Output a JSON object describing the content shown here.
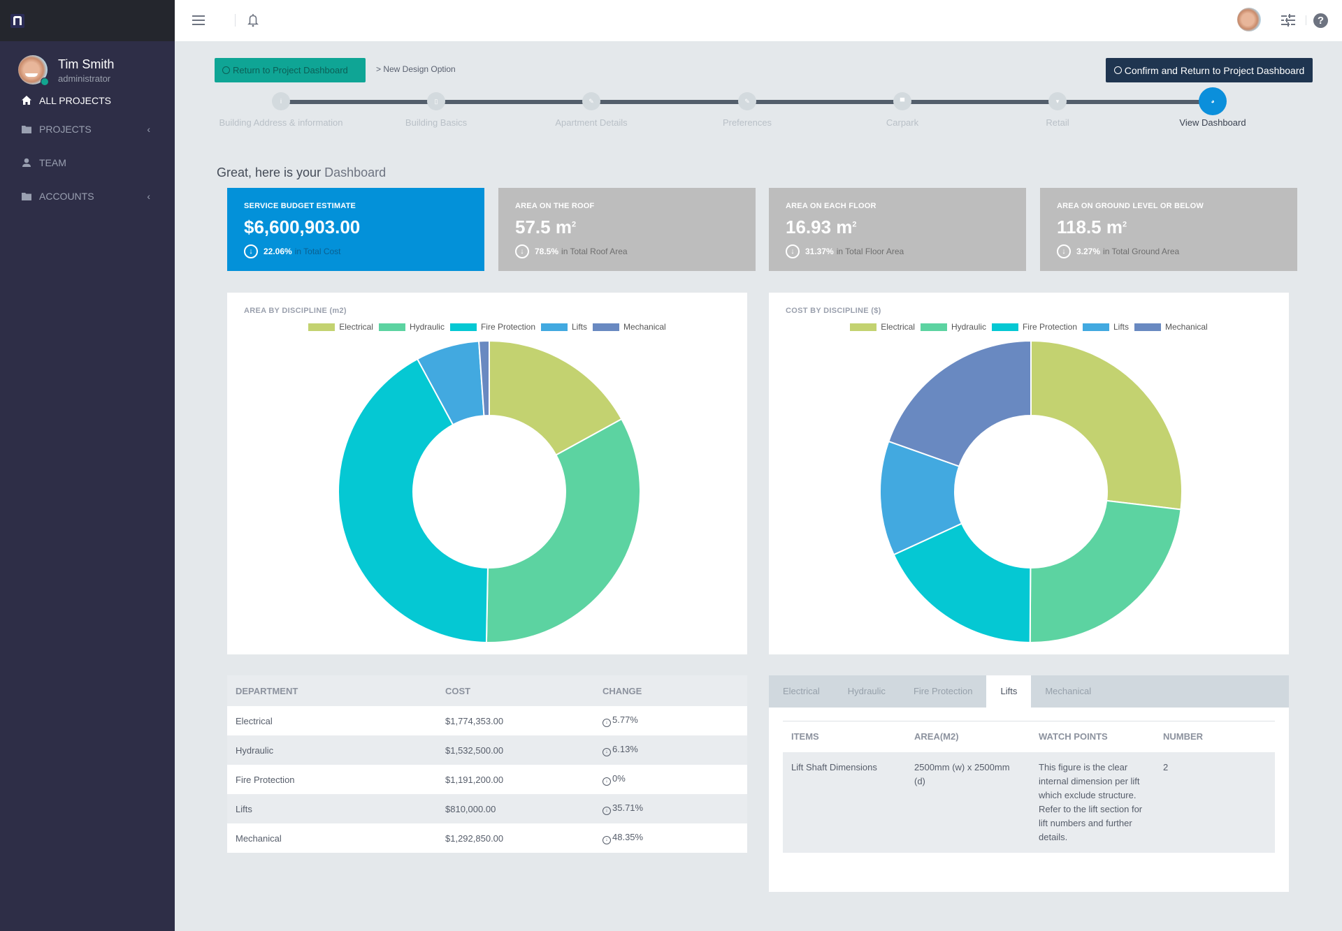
{
  "sidebar": {
    "user": {
      "name": "Tim Smith",
      "role": "administrator"
    },
    "items": [
      {
        "label": "ALL PROJECTS",
        "icon": "home-icon",
        "active": true
      },
      {
        "label": "PROJECTS",
        "icon": "folder-icon",
        "chevron": "‹"
      },
      {
        "label": "TEAM",
        "icon": "person-icon"
      },
      {
        "label": "ACCOUNTS",
        "icon": "folder-icon",
        "chevron": "‹"
      }
    ]
  },
  "header": {
    "return_button": "Return to Project Dashboard",
    "breadcrumb": "> New Design Option",
    "confirm_button": "Confirm and Return to Project Dashboard"
  },
  "steps": [
    {
      "label": "Building Address & information",
      "icon": "info-icon"
    },
    {
      "label": "Building Basics",
      "icon": "building-icon"
    },
    {
      "label": "Apartment Details",
      "icon": "wrench-icon"
    },
    {
      "label": "Preferences",
      "icon": "pencil-icon"
    },
    {
      "label": "Carpark",
      "icon": "car-icon"
    },
    {
      "label": "Retail",
      "icon": "cart-icon"
    },
    {
      "label": "View Dashboard",
      "icon": "dashboard-icon",
      "active": true
    }
  ],
  "greeting": {
    "text": "Great, here is your ",
    "highlight": "Dashboard"
  },
  "stats": [
    {
      "title": "SERVICE BUDGET ESTIMATE",
      "value": "$6,600,903.00",
      "unit": "",
      "pct": "22.06%",
      "rest": "in Total Cost"
    },
    {
      "title": "AREA ON THE ROOF",
      "value": "57.5 m",
      "unit": "2",
      "pct": "78.5%",
      "rest": "in Total Roof Area"
    },
    {
      "title": "AREA ON EACH FLOOR",
      "value": "16.93 m",
      "unit": "2",
      "pct": "31.37%",
      "rest": "in Total Floor Area"
    },
    {
      "title": "AREA ON GROUND LEVEL OR BELOW",
      "value": "118.5 m",
      "unit": "2",
      "pct": "3.27%",
      "rest": "in Total Ground Area"
    }
  ],
  "colors": {
    "Electrical": "#c3d270",
    "Hydraulic": "#5cd3a1",
    "Fire Protection": "#05c8d3",
    "Lifts": "#42a9e0",
    "Mechanical": "#6989c1",
    "primary": "#0391d9",
    "return": "#0fa595",
    "confirm": "#1f3550"
  },
  "chart_data": [
    {
      "type": "pie",
      "variant": "donut",
      "title": "AREA BY DISCIPLINE (m2)",
      "categories": [
        "Electrical",
        "Hydraulic",
        "Fire Protection",
        "Lifts",
        "Mechanical"
      ],
      "values": [
        17.0,
        33.3,
        41.8,
        6.8,
        1.1
      ],
      "legend": "top-center"
    },
    {
      "type": "pie",
      "variant": "donut",
      "title": "COST BY DISCIPLINE ($)",
      "categories": [
        "Electrical",
        "Hydraulic",
        "Fire Protection",
        "Lifts",
        "Mechanical"
      ],
      "values": [
        1774353,
        1532500,
        1191200,
        810000,
        1292850
      ],
      "legend": "top-center"
    }
  ],
  "dept_table": {
    "headers": [
      "DEPARTMENT",
      "COST",
      "CHANGE"
    ],
    "rows": [
      [
        "Electrical",
        "$1,774,353.00",
        "5.77%"
      ],
      [
        "Hydraulic",
        "$1,532,500.00",
        "6.13%"
      ],
      [
        "Fire Protection",
        "$1,191,200.00",
        "0%"
      ],
      [
        "Lifts",
        "$810,000.00",
        "35.71%"
      ],
      [
        "Mechanical",
        "$1,292,850.00",
        "48.35%"
      ]
    ]
  },
  "detail": {
    "tabs": [
      "Electrical",
      "Hydraulic",
      "Fire Protection",
      "Lifts",
      "Mechanical"
    ],
    "active_tab": "Lifts",
    "headers": [
      "ITEMS",
      "AREA(M2)",
      "WATCH POINTS",
      "NUMBER"
    ],
    "rows": [
      [
        "Lift Shaft Dimensions",
        "2500mm (w) x 2500mm (d)",
        "This figure is the clear internal dimension per lift which exclude structure. Refer to the lift section for lift numbers and further details.",
        "2"
      ]
    ]
  }
}
